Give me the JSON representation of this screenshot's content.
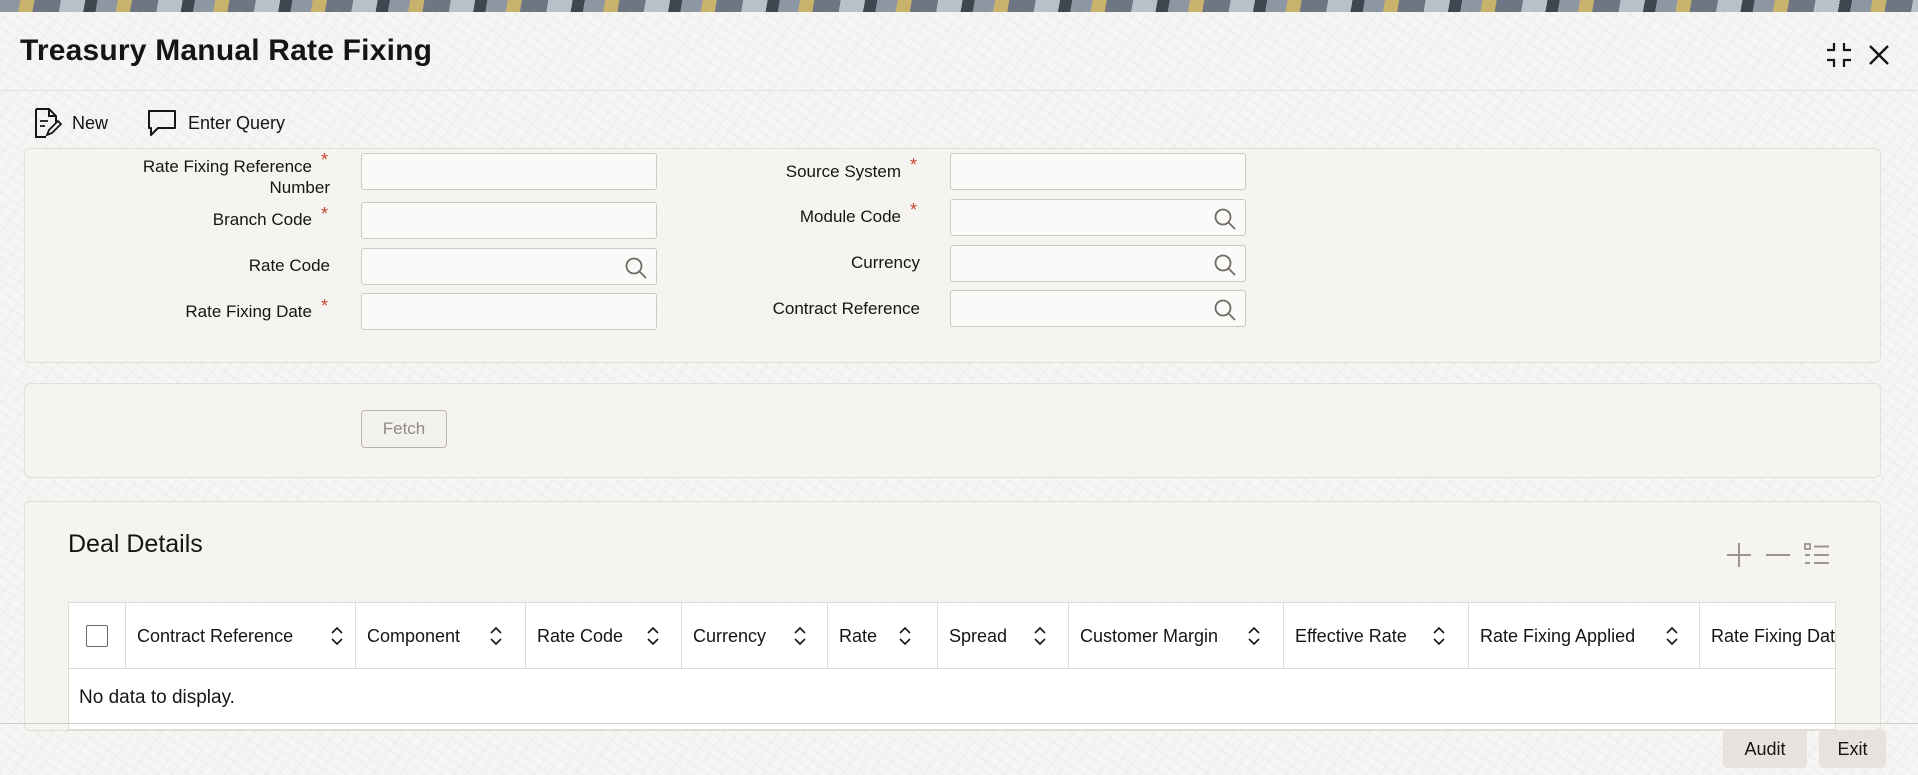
{
  "window": {
    "title": "Treasury Manual Rate Fixing"
  },
  "window_controls": {
    "collapse_icon": "compress-icon",
    "close_icon": "close-icon"
  },
  "toolbar": {
    "new_label": "New",
    "new_icon": "document-edit-icon",
    "enter_query_label": "Enter Query",
    "enter_query_icon": "chat-bubble-icon"
  },
  "form": {
    "required_marker": "*",
    "rate_fixing_ref_label_1": "Rate Fixing Reference",
    "rate_fixing_ref_label_2": "Number",
    "rate_fixing_ref_value": "",
    "branch_code_label": "Branch Code",
    "branch_code_value": "",
    "rate_code_label": "Rate Code",
    "rate_code_value": "",
    "rate_fixing_date_label": "Rate Fixing Date",
    "rate_fixing_date_value": "",
    "source_system_label": "Source System",
    "source_system_value": "",
    "module_code_label": "Module Code",
    "module_code_value": "",
    "currency_label": "Currency",
    "currency_value": "",
    "contract_reference_label": "Contract Reference",
    "contract_reference_value": ""
  },
  "fetch": {
    "label": "Fetch"
  },
  "deal_details": {
    "title": "Deal Details",
    "add_icon": "plus-icon",
    "remove_icon": "minus-icon",
    "columns_icon": "list-columns-icon",
    "columns": [
      "Contract Reference",
      "Component",
      "Rate Code",
      "Currency",
      "Rate",
      "Spread",
      "Customer Margin",
      "Effective Rate",
      "Rate Fixing Applied",
      "Rate Fixing Date"
    ],
    "empty_message": "No data to display."
  },
  "footer": {
    "audit_label": "Audit",
    "exit_label": "Exit"
  },
  "colors": {
    "required": "#c74634",
    "text": "#161513",
    "border": "#cdc9c4"
  }
}
